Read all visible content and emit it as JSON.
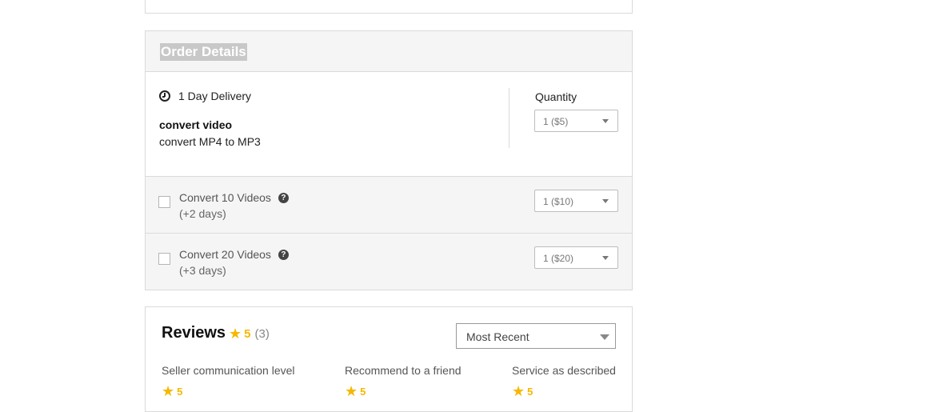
{
  "order": {
    "title": "Order Details",
    "delivery": "1 Day Delivery",
    "package_name": "convert video",
    "package_desc": "convert MP4 to MP3",
    "quantity_label": "Quantity",
    "quantity_selected": "1 ($5)",
    "extras": [
      {
        "title": "Convert 10 Videos",
        "days": "(+2 days)",
        "quantity_selected": "1 ($10)",
        "checked": false
      },
      {
        "title": "Convert 20 Videos",
        "days": "(+3 days)",
        "quantity_selected": "1 ($20)",
        "checked": false
      }
    ]
  },
  "reviews": {
    "title": "Reviews",
    "score": "5",
    "count": "(3)",
    "sort_selected": "Most Recent",
    "breakdown": [
      {
        "label": "Seller communication level",
        "score": "5"
      },
      {
        "label": "Recommend to a friend",
        "score": "5"
      },
      {
        "label": "Service as described",
        "score": "5"
      }
    ]
  },
  "colors": {
    "star": "#f5b800",
    "panel_bg": "#f5f5f5",
    "border": "#dadada"
  },
  "icons": {
    "delivery": "clock-icon",
    "help": "question-circle-icon",
    "rating": "star-icon"
  }
}
